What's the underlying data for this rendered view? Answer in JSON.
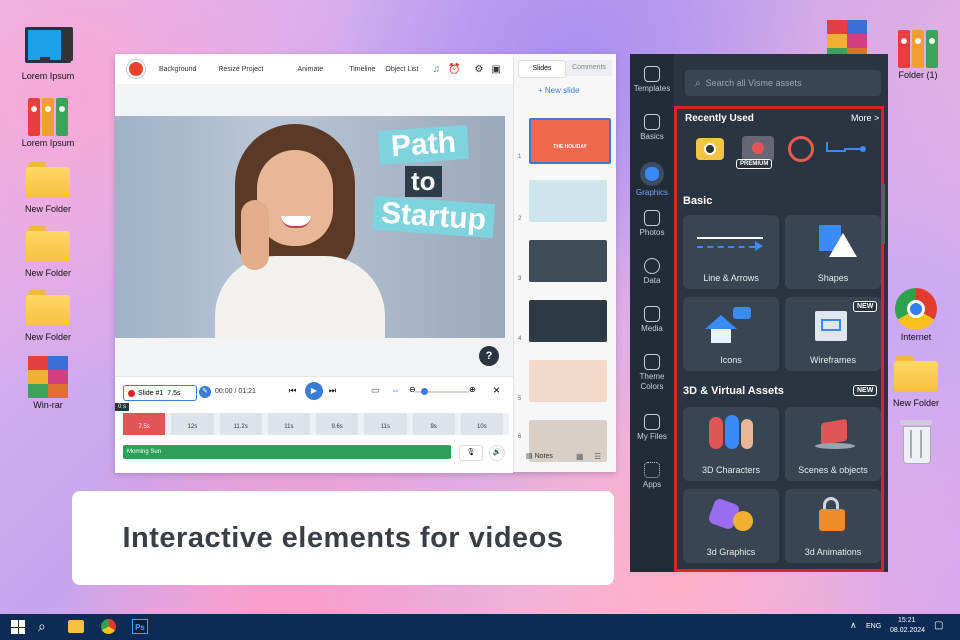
{
  "desktop": {
    "left_icons": [
      {
        "name": "monitor-icon",
        "label": "Lorem Ipsum"
      },
      {
        "name": "binders-icon",
        "label": "Lorem Ipsum"
      },
      {
        "name": "folder-icon",
        "label": "New Folder"
      },
      {
        "name": "folder-icon",
        "label": "New Folder"
      },
      {
        "name": "folder-icon",
        "label": "New Folder"
      },
      {
        "name": "winrar-icon",
        "label": "Win-rar"
      }
    ],
    "right_icons": [
      {
        "name": "winrar-icon",
        "label": ""
      },
      {
        "name": "binders-icon",
        "label": "Folder (1)"
      },
      {
        "name": "chrome-icon",
        "label": "Internet"
      },
      {
        "name": "folder-icon",
        "label": "New Folder"
      },
      {
        "name": "trash-icon",
        "label": ""
      }
    ]
  },
  "editor": {
    "toolbar": [
      "Background",
      "Resize Project",
      "Animate",
      "Timeline",
      "Object List"
    ],
    "hero_text": [
      "Path",
      "to",
      "Startup"
    ],
    "help": "?",
    "slides_tabs": [
      "Slides",
      "Comments"
    ],
    "new_slide": "+ New slide",
    "slide_numbers": [
      "1",
      "2",
      "3",
      "4",
      "5",
      "6"
    ],
    "thumb1_lines": [
      "THE HOLIDAY"
    ],
    "timeline": {
      "slide_label": "Slide #1",
      "slide_duration": "7.5s",
      "time": "00:00 / 01:21",
      "start_marker": "0 s",
      "clips": [
        "7.5s",
        "12s",
        "11.2s",
        "11s",
        "9.6s",
        "11s",
        "9s",
        "10s"
      ],
      "audio": "Morning Sun",
      "notes": "Notes"
    }
  },
  "assets_panel": {
    "search_placeholder": "Search all Visme assets",
    "rail": [
      "Templates",
      "Basics",
      "Graphics",
      "Photos",
      "Data",
      "Media",
      "Theme Colors",
      "My Files",
      "Apps"
    ],
    "active_rail": "Graphics",
    "recently_used": "Recently Used",
    "more": "More >",
    "premium": "PREMIUM",
    "basic_heading": "Basic",
    "basic_cards": [
      "Line & Arrows",
      "Shapes",
      "Icons",
      "Wireframes"
    ],
    "new_badge": "NEW",
    "assets3d_heading": "3D & Virtual Assets",
    "assets3d_cards": [
      "3D Characters",
      "Scenes & objects",
      "3d Graphics",
      "3d Animations"
    ],
    "highlight_color": "#e0202b"
  },
  "caption": "Interactive elements for videos",
  "taskbar": {
    "lang": "ENG",
    "time": "15:21",
    "date": "08.02.2024",
    "ps": "Ps"
  }
}
